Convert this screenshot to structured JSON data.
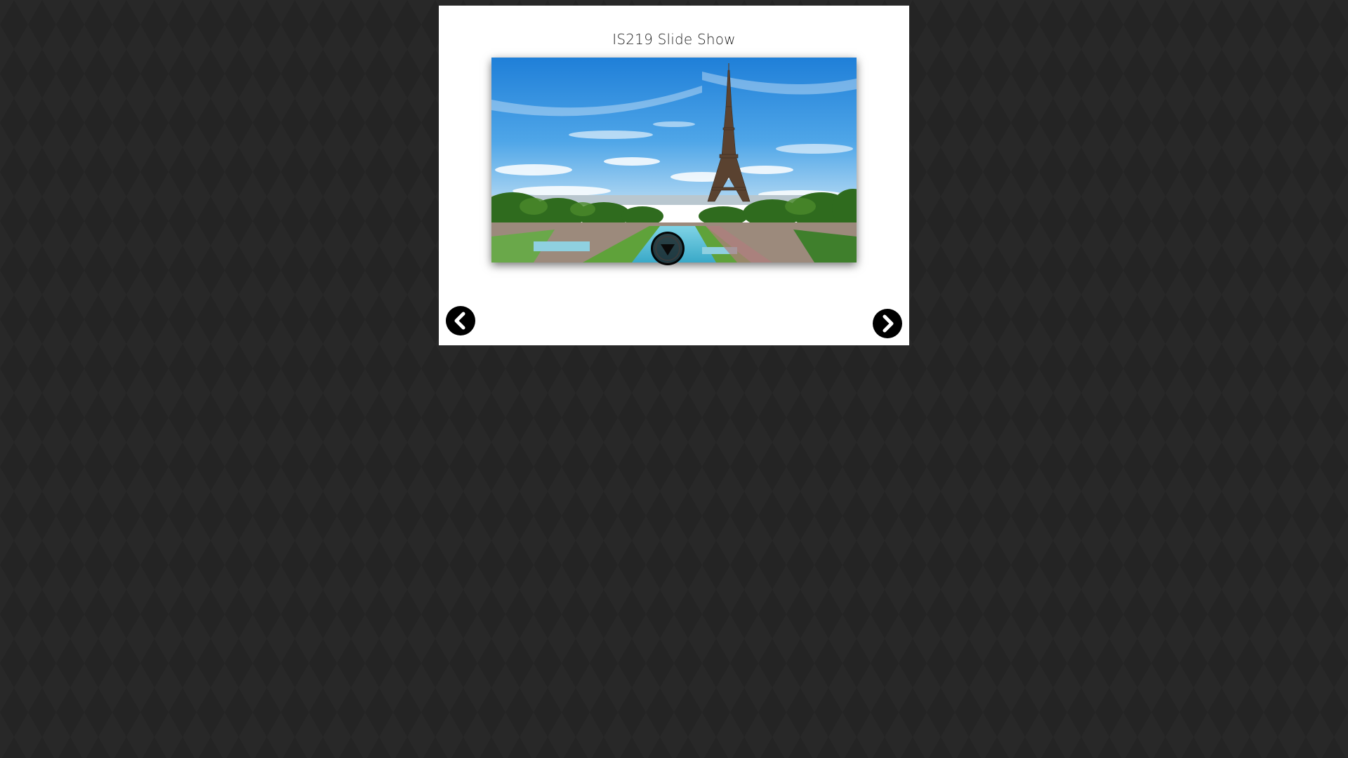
{
  "slideshow": {
    "title": "IS219 Slide Show",
    "current_slide": {
      "image_name": "eiffel-tower-paris"
    },
    "controls": {
      "prev_icon": "chevron-left-icon",
      "next_icon": "chevron-right-icon",
      "toggle_icon": "triangle-down-icon"
    }
  },
  "colors": {
    "background": "#242424",
    "panel": "#ffffff",
    "button": "#000000",
    "title_text": "#222222"
  }
}
